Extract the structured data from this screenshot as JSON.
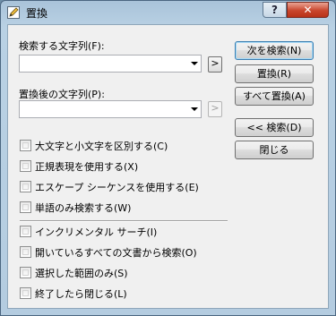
{
  "window": {
    "title": "置換"
  },
  "titlebar": {
    "help_label": "?",
    "close_label": "✕"
  },
  "find": {
    "label": "検索する文字列(F):",
    "value": "",
    "side_button": ">"
  },
  "replace": {
    "label": "置換後の文字列(P):",
    "value": "",
    "side_button": ">"
  },
  "buttons": {
    "find_next": "次を検索(N)",
    "replace": "置換(R)",
    "replace_all": "すべて置換(A)",
    "find_prev": "<< 検索(D)",
    "close": "閉じる"
  },
  "options": [
    {
      "label": "大文字と小文字を区別する(C)",
      "checked": false
    },
    {
      "label": "正規表現を使用する(X)",
      "checked": false
    },
    {
      "label": "エスケープ シーケンスを使用する(E)",
      "checked": false
    },
    {
      "label": "単語のみ検索する(W)",
      "checked": false
    }
  ],
  "options2": [
    {
      "label": "インクリメンタル サーチ(I)",
      "checked": false
    },
    {
      "label": "開いているすべての文書から検索(O)",
      "checked": false
    },
    {
      "label": "選択した範囲のみ(S)",
      "checked": false
    },
    {
      "label": "終了したら閉じる(L)",
      "checked": false
    }
  ],
  "colors": {
    "accent": "#3c7fb1",
    "close": "#c9462d"
  }
}
